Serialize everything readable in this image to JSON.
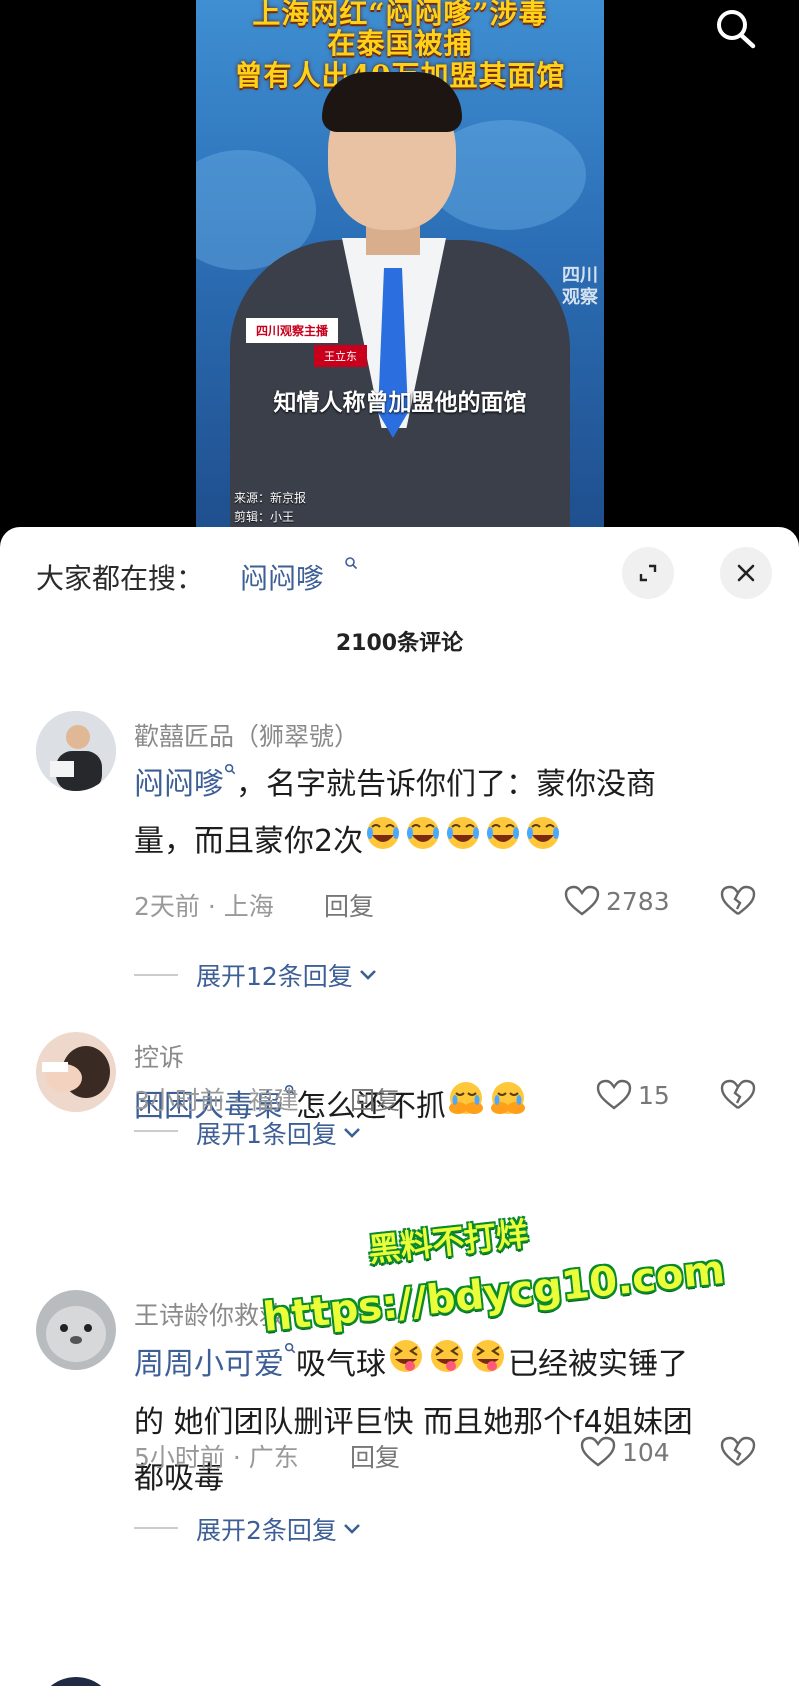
{
  "video": {
    "headline_lines": [
      "上海网红“闷闷嗲”涉毒",
      "在泰国被捕",
      "曾有人出40万加盟其面馆"
    ],
    "badge_program": "四川观察主播",
    "badge_name": "王立东",
    "caption": "知情人称曾加盟他的面馆",
    "logo_text": [
      "四川",
      "观察"
    ],
    "credit_source": "来源：新京报",
    "credit_editor": "剪辑：小王",
    "search_icon": "search-icon"
  },
  "panel": {
    "trending_label": "大家都在搜：",
    "trending_term": "闷闷嗲",
    "comment_count": "2100条评论",
    "expand_icon": "expand-icon",
    "close_icon": "close-icon"
  },
  "comments": [
    {
      "username": "歡囍匠品（狮翠號）",
      "mention": "闷闷嗲",
      "text_line1": "，名字就告诉你们了：蒙你没商",
      "text_line2": "量，而且蒙你2次",
      "emoji": "rofl-emoji x5",
      "time_location": "2天前 · 上海",
      "reply_label": "回复",
      "likes": "2783",
      "expand_label": "展开12条回复"
    },
    {
      "username": "控诉",
      "mention": "困困大毒枭",
      "text_line1": "怎么还不抓",
      "emoji": "crying-hug-emoji x2",
      "time_location": "3小时前 · 福建",
      "reply_label": "回复",
      "likes": "15",
      "expand_label": "展开1条回复"
    },
    {
      "username": "王诗龄你救救",
      "mention": "周周小可爱",
      "text_line1": "吸气球",
      "text_line1b": "已经被实锤了",
      "text_line2": "的 她们团队删评巨快 而且她那个f4姐妹团",
      "text_line3": "都吸毒",
      "emoji": "squint-tongue-emoji x3",
      "time_location": "5小时前 · 广东",
      "reply_label": "回复",
      "likes": "104",
      "expand_label": "展开2条回复"
    }
  ],
  "watermark": {
    "line1": "黑料不打烊",
    "line2": "https://bdycg10.com"
  },
  "colors": {
    "link_blue": "#3d5f96",
    "headline_yellow": "#ffd21a",
    "watermark_yellow": "#eaff3a",
    "watermark_green": "#0a8a2a"
  }
}
